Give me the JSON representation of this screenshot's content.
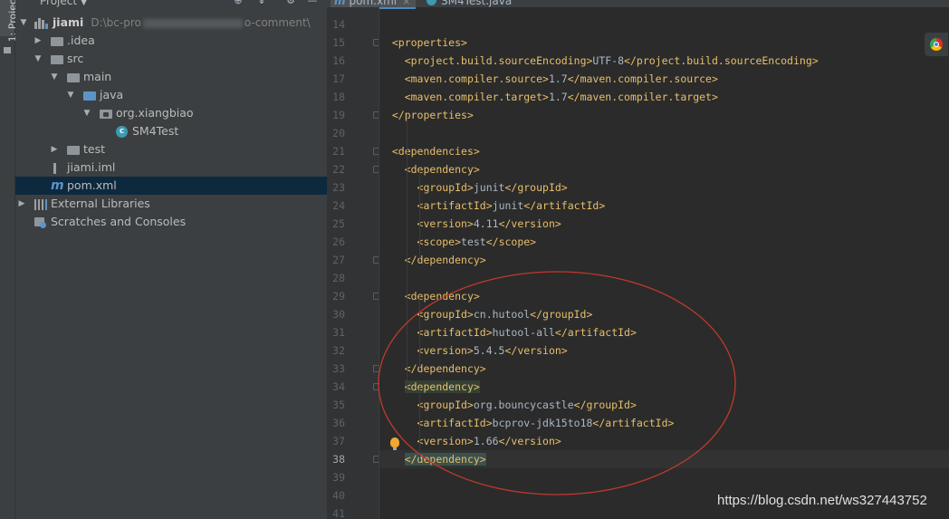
{
  "tool_window": {
    "stripe_label": "1: Project",
    "title": "Project"
  },
  "tree": [
    {
      "label": "jiami",
      "path": "D:\\bc-pro",
      "path_tail": "o-comment\\"
    },
    {
      "label": ".idea"
    },
    {
      "label": "src"
    },
    {
      "label": "main"
    },
    {
      "label": "java"
    },
    {
      "label": "org.xiangbiao"
    },
    {
      "label": "SM4Test"
    },
    {
      "label": "test"
    },
    {
      "label": "jiami.iml"
    },
    {
      "label": "pom.xml"
    },
    {
      "label": "External Libraries"
    },
    {
      "label": "Scratches and Consoles"
    }
  ],
  "tabs": [
    {
      "label": "pom.xml",
      "close": "×",
      "active": true
    },
    {
      "label": "SM4Test.java",
      "active": false
    }
  ],
  "code_lines": [
    {
      "n": "14",
      "t": ""
    },
    {
      "n": "15",
      "t": "<properties>"
    },
    {
      "n": "16",
      "t": "  <project.build.sourceEncoding>UTF-8</project.build.sourceEncoding>"
    },
    {
      "n": "17",
      "t": "  <maven.compiler.source>1.7</maven.compiler.source>"
    },
    {
      "n": "18",
      "t": "  <maven.compiler.target>1.7</maven.compiler.target>"
    },
    {
      "n": "19",
      "t": "</properties>"
    },
    {
      "n": "20",
      "t": ""
    },
    {
      "n": "21",
      "t": "<dependencies>"
    },
    {
      "n": "22",
      "t": "  <dependency>"
    },
    {
      "n": "23",
      "t": "    <groupId>junit</groupId>"
    },
    {
      "n": "24",
      "t": "    <artifactId>junit</artifactId>"
    },
    {
      "n": "25",
      "t": "    <version>4.11</version>"
    },
    {
      "n": "26",
      "t": "    <scope>test</scope>"
    },
    {
      "n": "27",
      "t": "  </dependency>"
    },
    {
      "n": "28",
      "t": ""
    },
    {
      "n": "29",
      "t": "  <dependency>"
    },
    {
      "n": "30",
      "t": "    <groupId>cn.hutool</groupId>"
    },
    {
      "n": "31",
      "t": "    <artifactId>hutool-all</artifactId>"
    },
    {
      "n": "32",
      "t": "    <version>5.4.5</version>"
    },
    {
      "n": "33",
      "t": "  </dependency>"
    },
    {
      "n": "34",
      "t": "  <dependency>"
    },
    {
      "n": "35",
      "t": "    <groupId>org.bouncycastle</groupId>"
    },
    {
      "n": "36",
      "t": "    <artifactId>bcprov-jdk15to18</artifactId>"
    },
    {
      "n": "37",
      "t": "    <version>1.66</version>"
    },
    {
      "n": "38",
      "t": "  </dependency>"
    },
    {
      "n": "39",
      "t": ""
    },
    {
      "n": "40",
      "t": ""
    },
    {
      "n": "41",
      "t": ""
    }
  ],
  "current_line": "38",
  "watermark": "https://blog.csdn.net/ws327443752",
  "colors": {
    "tag": "#e8bf6a",
    "text": "#a9b7c6",
    "selection": "#0d293e",
    "annotation": "#c0392b"
  }
}
